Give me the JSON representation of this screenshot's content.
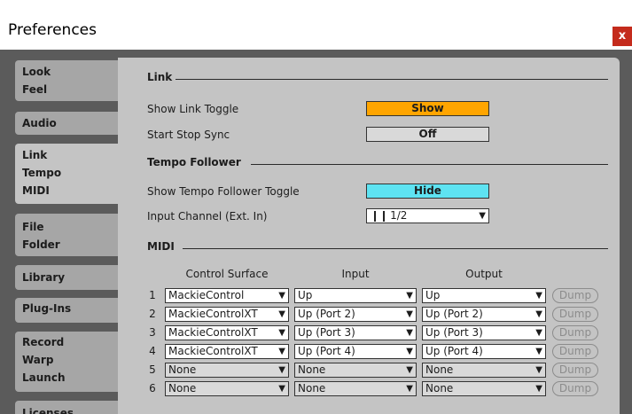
{
  "window": {
    "title": "Preferences",
    "close_label": "x"
  },
  "tabs": [
    {
      "lines": [
        "Look",
        "Feel"
      ]
    },
    {
      "lines": [
        "Audio"
      ]
    },
    {
      "lines": [
        "Link",
        "Tempo",
        "MIDI"
      ]
    },
    {
      "lines": [
        "File",
        "Folder"
      ]
    },
    {
      "lines": [
        "Library"
      ]
    },
    {
      "lines": [
        "Plug-Ins"
      ]
    },
    {
      "lines": [
        "Record",
        "Warp",
        "Launch"
      ]
    },
    {
      "lines": [
        "Licenses"
      ]
    }
  ],
  "link": {
    "section": "Link",
    "show_link_toggle_label": "Show Link Toggle",
    "show_link_toggle_value": "Show",
    "start_stop_sync_label": "Start Stop Sync",
    "start_stop_sync_value": "Off"
  },
  "tempo_follower": {
    "section": "Tempo Follower",
    "show_toggle_label": "Show Tempo Follower Toggle",
    "show_toggle_value": "Hide",
    "input_channel_label": "Input Channel (Ext. In)",
    "input_channel_value": "1/2"
  },
  "midi": {
    "section": "MIDI",
    "headers": {
      "control_surface": "Control Surface",
      "input": "Input",
      "output": "Output"
    },
    "dump_label": "Dump",
    "rows": [
      {
        "num": "1",
        "surface": "MackieControl",
        "input": "Up",
        "output": "Up"
      },
      {
        "num": "2",
        "surface": "MackieControlXT",
        "input": "Up (Port 2)",
        "output": "Up (Port 2)"
      },
      {
        "num": "3",
        "surface": "MackieControlXT",
        "input": "Up (Port 3)",
        "output": "Up (Port 3)"
      },
      {
        "num": "4",
        "surface": "MackieControlXT",
        "input": "Up (Port 4)",
        "output": "Up (Port 4)"
      },
      {
        "num": "5",
        "surface": "None",
        "input": "None",
        "output": "None"
      },
      {
        "num": "6",
        "surface": "None",
        "input": "None",
        "output": "None"
      }
    ]
  },
  "colors": {
    "show_toggle": "#ffa500",
    "hide_toggle": "#5ee3f2",
    "close_button": "#c42b1c",
    "panel": "#c4c4c4",
    "background": "#5b5b5b"
  }
}
